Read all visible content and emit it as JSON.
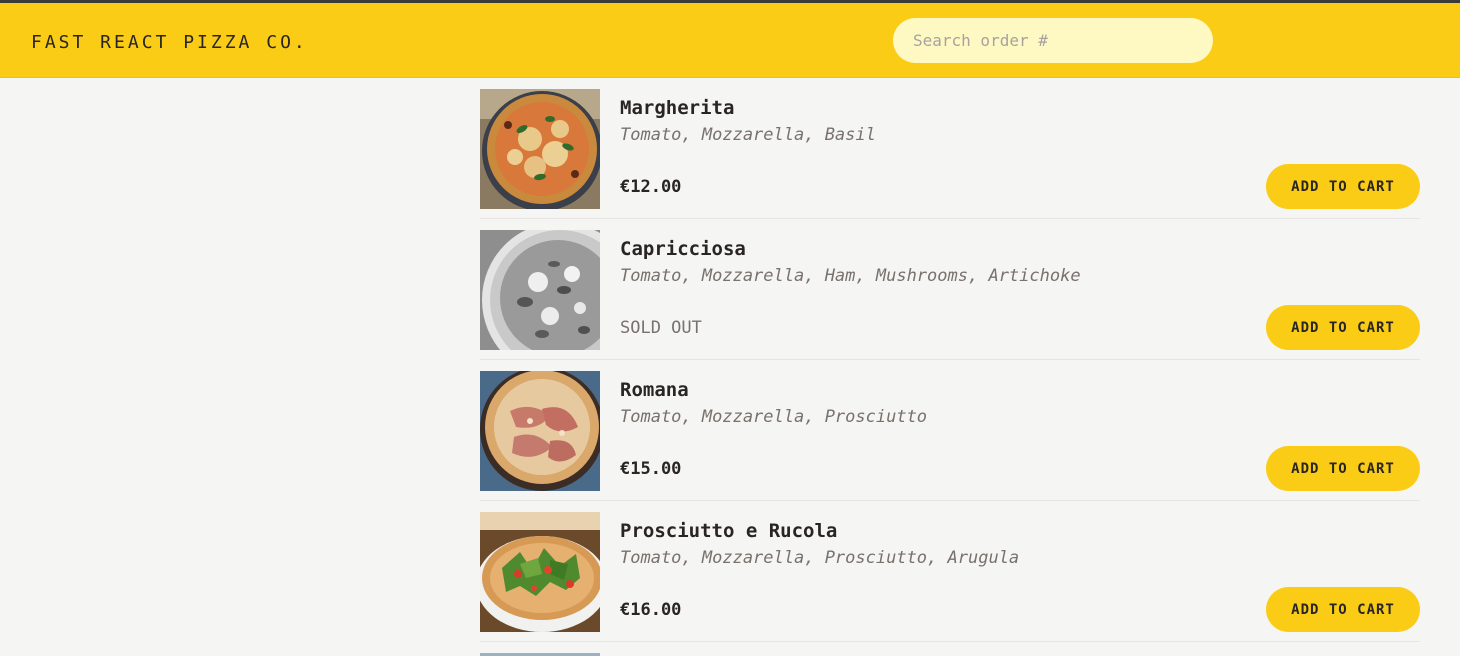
{
  "header": {
    "brand": "FAST REACT PIZZA CO.",
    "search_placeholder": "Search order #",
    "accent": "#facc15"
  },
  "menu": [
    {
      "name": "Margherita",
      "ingredients": "Tomato, Mozzarella, Basil",
      "price": "€12.00",
      "sold_out": false,
      "button": "ADD TO CART"
    },
    {
      "name": "Capricciosa",
      "ingredients": "Tomato, Mozzarella, Ham, Mushrooms, Artichoke",
      "price": "SOLD OUT",
      "sold_out": true,
      "button": "ADD TO CART"
    },
    {
      "name": "Romana",
      "ingredients": "Tomato, Mozzarella, Prosciutto",
      "price": "€15.00",
      "sold_out": false,
      "button": "ADD TO CART"
    },
    {
      "name": "Prosciutto e Rucola",
      "ingredients": "Tomato, Mozzarella, Prosciutto, Arugula",
      "price": "€16.00",
      "sold_out": false,
      "button": "ADD TO CART"
    }
  ]
}
